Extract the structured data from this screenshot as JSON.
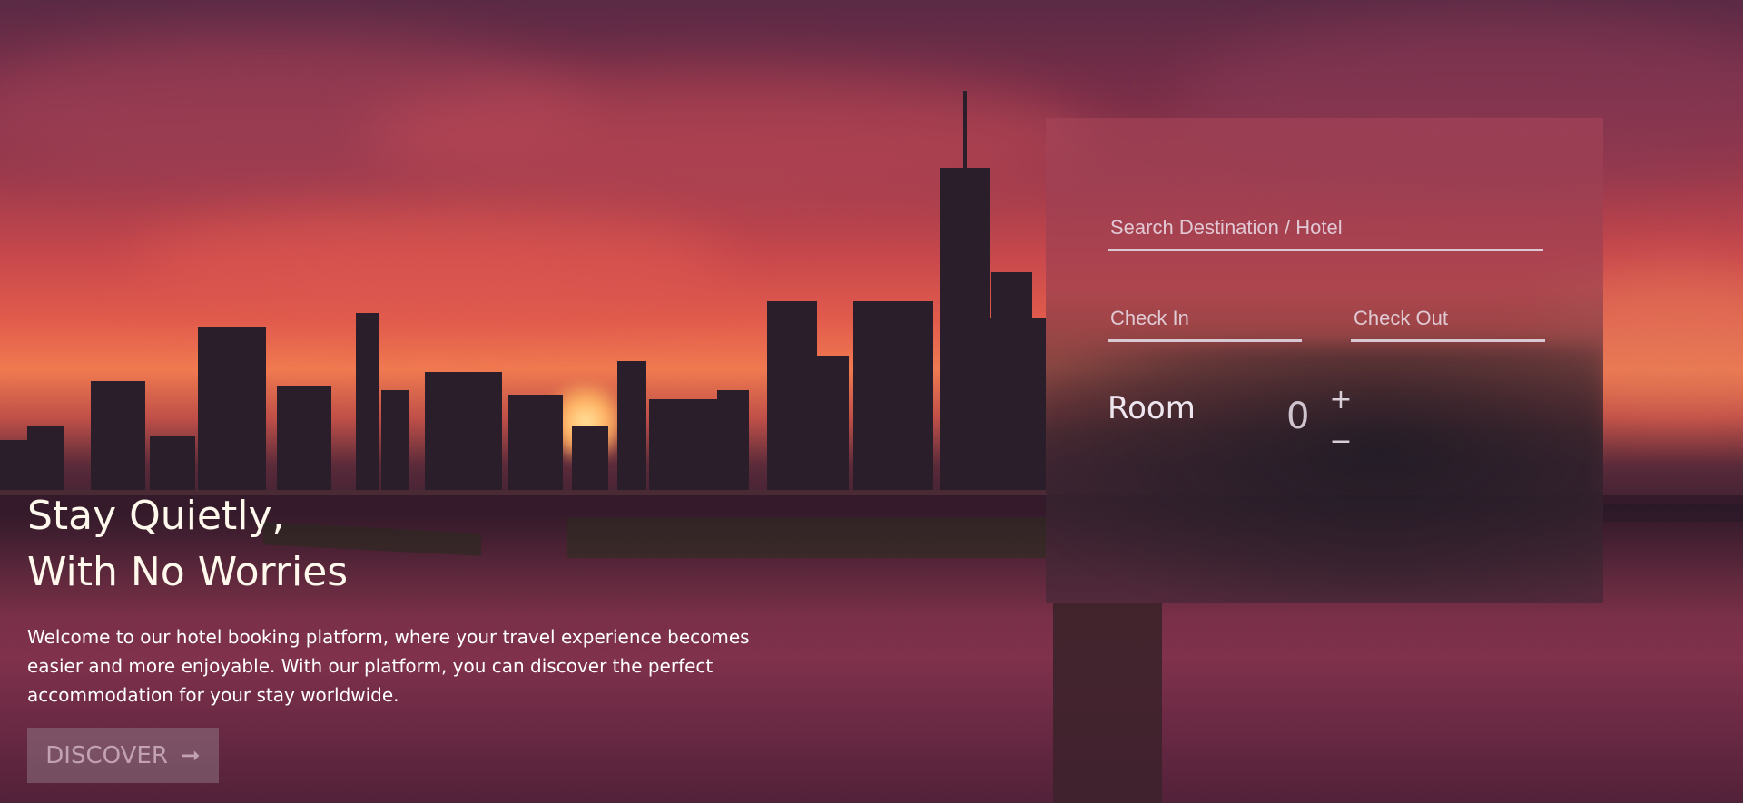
{
  "hero": {
    "headline_line1": "Stay Quietly,",
    "headline_line2": "With No Worries",
    "description": "Welcome to our hotel booking platform, where your travel experience becomes easier and more enjoyable. With our platform, you can discover the perfect accommodation for your stay worldwide.",
    "discover_label": "DISCOVER",
    "discover_icon": "arrow-right-icon"
  },
  "booking": {
    "search_placeholder": "Search Destination / Hotel",
    "checkin_placeholder": "Check In",
    "checkout_placeholder": "Check Out",
    "room_label": "Room",
    "room_count": "0",
    "plus_label": "+",
    "minus_label": "−"
  },
  "colors": {
    "headline_text": "#fff8ec",
    "field_underline": "#e6e1eb",
    "discover_bg": "#968291"
  }
}
